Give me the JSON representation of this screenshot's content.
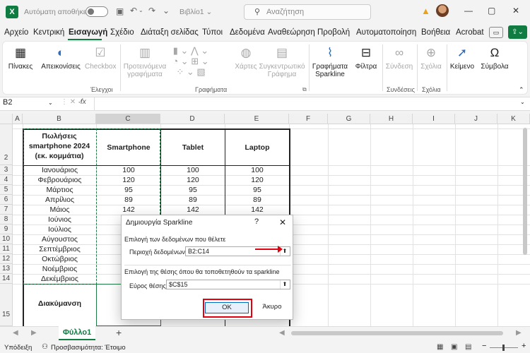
{
  "title_bar": {
    "app_icon": "X",
    "autosave_label": "Αυτόματη αποθήκευση",
    "file_name": "Βιβλίο1 ⌄",
    "search_placeholder": "Αναζήτηση"
  },
  "menu": {
    "items": [
      "Αρχείο",
      "Κεντρική",
      "Εισαγωγή",
      "Σχέδιο",
      "Διάταξη σελίδας",
      "Τύποι",
      "Δεδομένα",
      "Αναθεώρηση",
      "Προβολή",
      "Αυτοματοποίηση",
      "Βοήθεια",
      "Acrobat"
    ],
    "active": "Εισαγωγή"
  },
  "ribbon": {
    "tables": "Πίνακες",
    "illustrations": "Απεικονίσεις",
    "checkbox": "Checkbox",
    "recommended_charts": "Προτεινόμενα γραφήματα",
    "maps": "Χάρτες",
    "pivot_chart": "Συγκεντρωτικό Γράφημα",
    "sparklines": "Γραφήματα Sparkline",
    "filters": "Φίλτρα",
    "link": "Σύνδεση",
    "comment": "Σχόλια",
    "text": "Κείμενο",
    "symbols": "Σύμβολα",
    "group_controls": "Έλεγχοι",
    "group_charts": "Γραφήματα",
    "group_links": "Συνδέσεις",
    "group_comments": "Σχόλια"
  },
  "formula_bar": {
    "name_box": "B2",
    "fx": "fx",
    "formula": ""
  },
  "columns": [
    "A",
    "B",
    "C",
    "D",
    "E",
    "F",
    "G",
    "H",
    "I",
    "J",
    "K"
  ],
  "rows": [
    "2",
    "3",
    "4",
    "5",
    "6",
    "7",
    "8",
    "9",
    "10",
    "11",
    "12",
    "13",
    "14",
    "15"
  ],
  "table": {
    "header": [
      "Πωλήσεις smartphone 2024 (εκ. κομμάτια)",
      "Smartphone",
      "Tablet",
      "Laptop"
    ],
    "months": [
      "Ιανουάριος",
      "Φεβρουάριος",
      "Μάρτιος",
      "Απρίλιος",
      "Μάιος",
      "Ιούνιος",
      "Ιούλιος",
      "Αύγουστος",
      "Σεπτέμβριος",
      "Οκτώβριος",
      "Νοέμβριος",
      "Δεκέμβριος"
    ],
    "values": [
      [
        "100",
        "100",
        "100"
      ],
      [
        "120",
        "120",
        "120"
      ],
      [
        "95",
        "95",
        "95"
      ],
      [
        "89",
        "89",
        "89"
      ],
      [
        "142",
        "142",
        "142"
      ]
    ],
    "footer": "Διακύμανση"
  },
  "dialog": {
    "title": "Δημιουργία Sparkline",
    "close": "✕",
    "data_section": "Επιλογή των δεδομένων που θέλετε",
    "data_range_label": "Περιοχή δεδομένων:",
    "data_range_value": "B2:C14",
    "location_section": "Επιλογή της θέσης όπου θα τοποθετηθούν τα sparkline",
    "location_label": "Εύρος θέσης:",
    "location_value": "$C$15",
    "ok": "OK",
    "cancel": "Άκυρο"
  },
  "sheets": {
    "active": "Φύλλο1",
    "add": "+"
  },
  "status": {
    "mode": "Υπόδειξη",
    "accessibility": "Προσβασιμότητα: Έτοιμο"
  },
  "colors": {
    "excel_green": "#107c41",
    "highlight_red": "#e3000f"
  }
}
